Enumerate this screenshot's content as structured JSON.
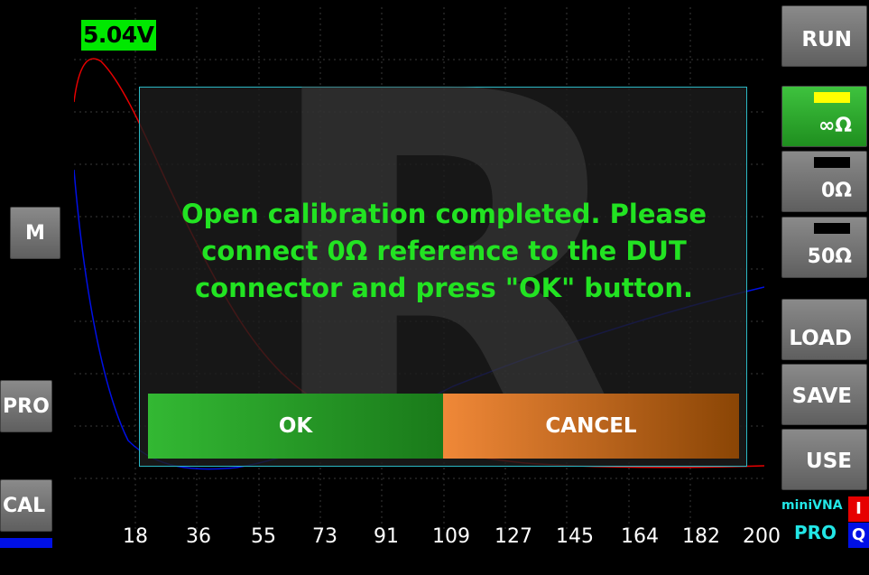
{
  "display": {
    "voltage": "5.04V",
    "watermark": "R",
    "x_ticks": [
      "18",
      "36",
      "55",
      "73",
      "91",
      "109",
      "127",
      "145",
      "164",
      "182",
      "200"
    ]
  },
  "right_panel": {
    "run": "RUN",
    "cal_open": "∞Ω",
    "cal_short": "0Ω",
    "cal_load": "50Ω",
    "load": "LOAD",
    "save": "SAVE",
    "use": "USE"
  },
  "left_panel": {
    "m": "M",
    "pro": "PRO",
    "cal": "CAL"
  },
  "dialog": {
    "message_lines": [
      "Open calibration completed. Please",
      "connect 0Ω reference to the DUT",
      "connector and press \"OK\" button."
    ],
    "ok": "OK",
    "cancel": "CANCEL"
  },
  "brand": {
    "line1": "miniVNA",
    "line2": "PRO",
    "channel_i": "I",
    "channel_q": "Q"
  },
  "colors": {
    "accent_green": "#22e322",
    "dialog_border": "#2bb8c4",
    "trace_i": "#e60000",
    "trace_q": "#0010e6"
  }
}
